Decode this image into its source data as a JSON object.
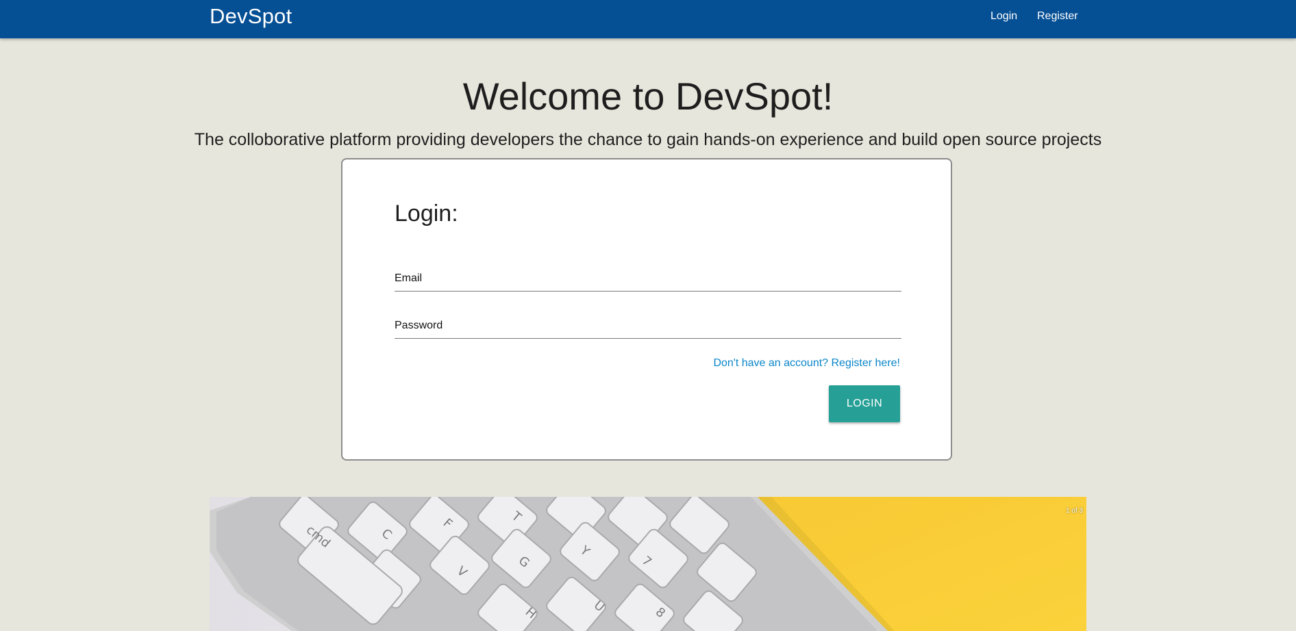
{
  "nav": {
    "brand": "DevSpot",
    "login": "Login",
    "register": "Register"
  },
  "hero": {
    "title": "Welcome to DevSpot!",
    "subtitle": "The colloborative platform providing developers the chance to gain hands-on experience and build open source projects"
  },
  "login_form": {
    "title": "Login:",
    "email_placeholder": "Email",
    "email_value": "",
    "password_placeholder": "Password",
    "password_value": "",
    "register_link": "Don't have an account? Register here!",
    "submit_label": "LOGIN"
  },
  "carousel": {
    "counter": "1 of 3",
    "image_subject": "keyboard-on-yellow-desk"
  },
  "colors": {
    "navbar": "#054f94",
    "background": "#e7e6dc",
    "button": "#26a096",
    "link": "#0a86c9"
  }
}
